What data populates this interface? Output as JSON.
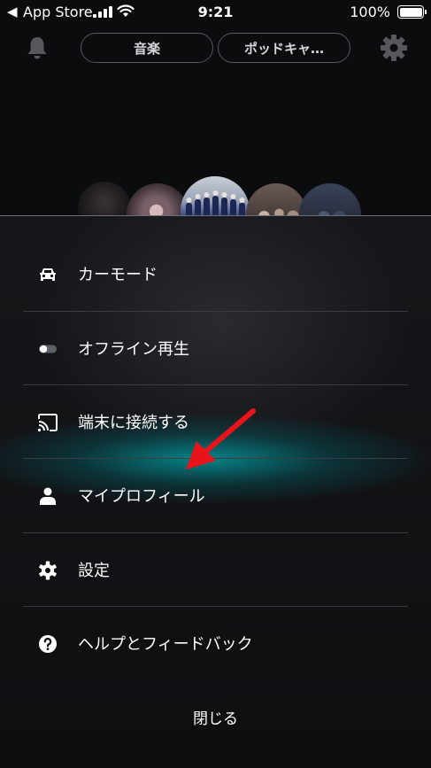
{
  "status_bar": {
    "back_glyph": "◀",
    "carrier": "App Store",
    "time": "9:21",
    "battery": "100%"
  },
  "header": {
    "tabs": [
      {
        "label": "音楽"
      },
      {
        "label": "ポッドキャ…"
      }
    ],
    "icons": [
      "bell-icon",
      "gear-icon"
    ]
  },
  "menu": {
    "items": [
      {
        "label": "カーモード",
        "icon": "car-icon"
      },
      {
        "label": "オフライン再生",
        "icon": "toggle-icon"
      },
      {
        "label": "端末に接続する",
        "icon": "cast-icon"
      },
      {
        "label": "マイプロフィール",
        "icon": "person-icon"
      },
      {
        "label": "設定",
        "icon": "gear-icon"
      },
      {
        "label": "ヘルプとフィードバック",
        "icon": "help-icon"
      }
    ],
    "close_label": "閉じる"
  },
  "colors": {
    "background": "#0b0c0e",
    "highlight": "#00a8ad",
    "annotation_arrow": "#e8141b"
  }
}
